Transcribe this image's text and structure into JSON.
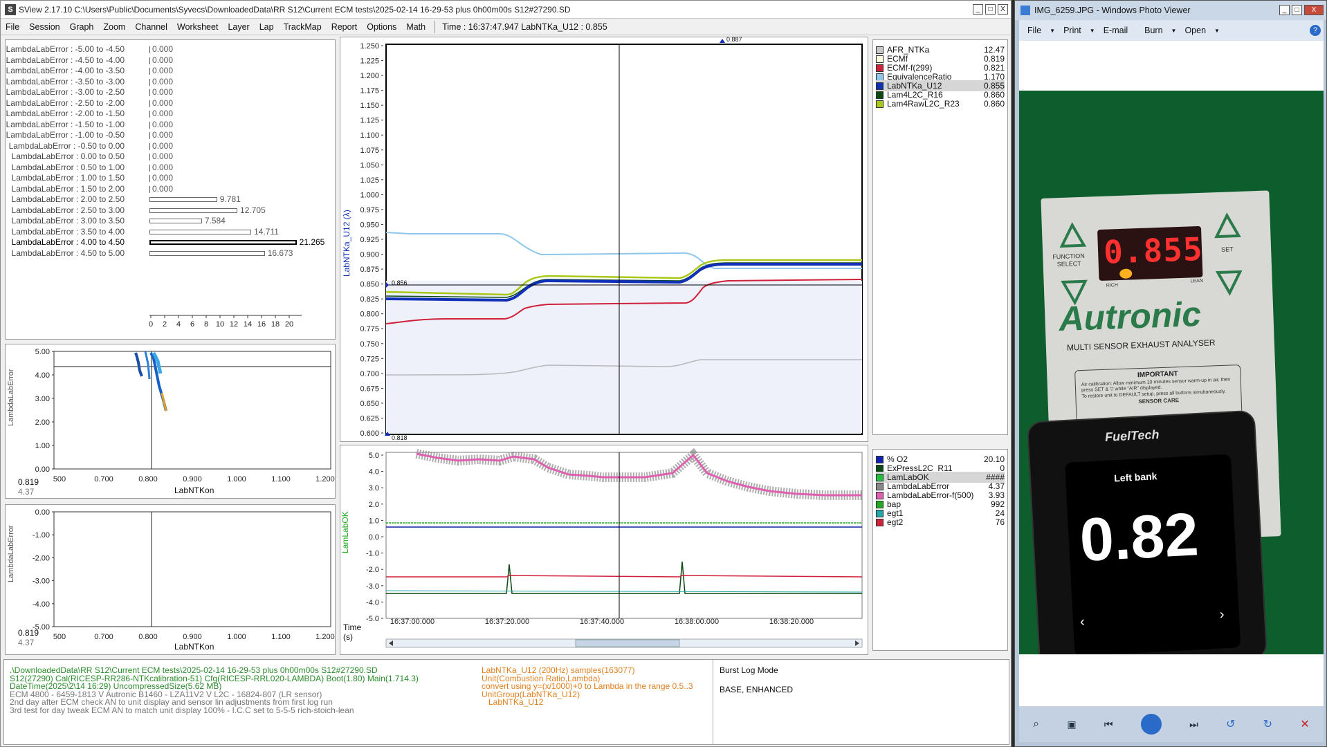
{
  "app": {
    "title": "SView 2.17.10   C:\\Users\\Public\\Documents\\Syvecs\\DownloadedData\\RR S12\\Current ECM tests\\2025-02-14 16-29-53 plus 0h00m00s S12#27290.SD",
    "window_buttons": [
      "_",
      "□",
      "X"
    ]
  },
  "menu": {
    "items": [
      "File",
      "Session",
      "Graph",
      "Zoom",
      "Channel",
      "Worksheet",
      "Layer",
      "Lap",
      "TrackMap",
      "Report",
      "Options",
      "Math"
    ],
    "time_readout": "Time : 16:37:47.947   LabNTKa_U12 : 0.855"
  },
  "histogram": {
    "rows": [
      {
        "label": "LambdaLabError : -5.00 to -4.50",
        "value": "0.000",
        "n": 0
      },
      {
        "label": "LambdaLabError : -4.50 to -4.00",
        "value": "0.000",
        "n": 0
      },
      {
        "label": "LambdaLabError : -4.00 to -3.50",
        "value": "0.000",
        "n": 0
      },
      {
        "label": "LambdaLabError : -3.50 to -3.00",
        "value": "0.000",
        "n": 0
      },
      {
        "label": "LambdaLabError : -3.00 to -2.50",
        "value": "0.000",
        "n": 0
      },
      {
        "label": "LambdaLabError : -2.50 to -2.00",
        "value": "0.000",
        "n": 0
      },
      {
        "label": "LambdaLabError : -2.00 to -1.50",
        "value": "0.000",
        "n": 0
      },
      {
        "label": "LambdaLabError : -1.50 to -1.00",
        "value": "0.000",
        "n": 0
      },
      {
        "label": "LambdaLabError : -1.00 to -0.50",
        "value": "0.000",
        "n": 0
      },
      {
        "label": "LambdaLabError : -0.50 to 0.00",
        "value": "0.000",
        "n": 0
      },
      {
        "label": "LambdaLabError : 0.00 to 0.50",
        "value": "0.000",
        "n": 0
      },
      {
        "label": "LambdaLabError : 0.50 to 1.00",
        "value": "0.000",
        "n": 0
      },
      {
        "label": "LambdaLabError : 1.00 to 1.50",
        "value": "0.000",
        "n": 0
      },
      {
        "label": "LambdaLabError : 1.50 to 2.00",
        "value": "0.000",
        "n": 0
      },
      {
        "label": "LambdaLabError : 2.00 to 2.50",
        "value": "9.781",
        "n": 9.781
      },
      {
        "label": "LambdaLabError : 2.50 to 3.00",
        "value": "12.705",
        "n": 12.705
      },
      {
        "label": "LambdaLabError : 3.00 to 3.50",
        "value": "7.584",
        "n": 7.584
      },
      {
        "label": "LambdaLabError : 3.50 to 4.00",
        "value": "14.711",
        "n": 14.711
      },
      {
        "label": "LambdaLabError : 4.00 to 4.50",
        "value": "21.265",
        "n": 21.265,
        "selected": true
      },
      {
        "label": "LambdaLabError : 4.50 to 5.00",
        "value": "16.673",
        "n": 16.673
      }
    ],
    "axis_ticks": [
      "0",
      "2",
      "4",
      "6",
      "8",
      "10",
      "12",
      "14",
      "16",
      "18",
      "20"
    ]
  },
  "scatter1": {
    "ylabel": "LambdaLabError",
    "xlabel": "LabNTKon",
    "yticks": [
      "5.00",
      "4.00",
      "3.00",
      "2.00",
      "1.00",
      "0.00"
    ],
    "xticks": [
      "500",
      "0.700",
      "0.800",
      "0.900",
      "1.000",
      "1.100",
      "1.200"
    ],
    "readout_x": "0.819",
    "readout_y": "4.37"
  },
  "scatter2": {
    "ylabel": "LambdaLabError",
    "xlabel": "LabNTKon",
    "yticks": [
      "0.00",
      "-1.00",
      "-2.00",
      "-3.00",
      "-4.00",
      "-5.00"
    ],
    "xticks": [
      "500",
      "0.700",
      "0.800",
      "0.900",
      "1.000",
      "1.100",
      "1.200"
    ],
    "readout_x": "0.819",
    "readout_y": "4.37"
  },
  "main_graph": {
    "ylabel": "LabNTKa_U12 (λ)",
    "yticks": [
      "1.250",
      "1.225",
      "1.200",
      "1.175",
      "1.150",
      "1.125",
      "1.100",
      "1.075",
      "1.050",
      "1.025",
      "1.000",
      "0.975",
      "0.950",
      "0.925",
      "0.900",
      "0.875",
      "0.850",
      "0.825",
      "0.800",
      "0.775",
      "0.750",
      "0.725",
      "0.700",
      "0.675",
      "0.650",
      "0.625",
      "0.600"
    ],
    "max_marker": "0.887",
    "min_marker": "0.818",
    "cursor_marker": "0.856"
  },
  "lower_graph": {
    "ylabel": "LamLabOK",
    "yticks": [
      "5.0",
      "4.0",
      "3.0",
      "2.0",
      "1.0",
      "0.0",
      "-1.0",
      "-2.0",
      "-3.0",
      "-4.0",
      "-5.0"
    ],
    "xlabel": "Time\n(s)",
    "xlabel_line1": "Time",
    "xlabel_line2": "(s)",
    "xticks": [
      "16:37:00.000",
      "16:37:20.000",
      "16:37:40.000",
      "16:38:00.000",
      "16:38:20.000"
    ]
  },
  "legend_top": [
    {
      "name": "AFR_NTKa",
      "value": "12.47",
      "color": "#c8c8c8"
    },
    {
      "name": "ECMf",
      "value": "0.819",
      "color": "#fffbe0"
    },
    {
      "name": "ECMf-f(299)",
      "value": "0.821",
      "color": "#d0203a"
    },
    {
      "name": "EquivalenceRatio",
      "value": "1.170",
      "color": "#8fc6ec"
    },
    {
      "name": "LabNTKa_U12",
      "value": "0.855",
      "color": "#1030b8",
      "selected": true
    },
    {
      "name": "Lam4L2C_R16",
      "value": "0.860",
      "color": "#0b4a12"
    },
    {
      "name": "Lam4RawL2C_R23",
      "value": "0.860",
      "color": "#a8c818"
    }
  ],
  "legend_bottom": [
    {
      "name": "% O2",
      "value": "20.10",
      "color": "#1020b0"
    },
    {
      "name": "ExPressL2C_R11",
      "value": "0",
      "color": "#0b4a12"
    },
    {
      "name": "LamLabOK",
      "value": "####",
      "color": "#22c040",
      "selected": true
    },
    {
      "name": "LambdaLabError",
      "value": "4.37",
      "color": "#888888"
    },
    {
      "name": "LambdaLabError-f(500)",
      "value": "3.93",
      "color": "#e060b0"
    },
    {
      "name": "bap",
      "value": "992",
      "color": "#22aa22"
    },
    {
      "name": "egt1",
      "value": "24",
      "color": "#20a8a8"
    },
    {
      "name": "egt2",
      "value": "76",
      "color": "#d0203a"
    }
  ],
  "status": {
    "left": [
      {
        "text": ".\\DownloadedData\\RR S12\\Current ECM tests\\2025-02-14 16-29-53 plus 0h00m00s S12#27290.SD",
        "color": "#2a8a2a"
      },
      {
        "text": "S12(27290) Cal(RICESP-RR286-NTKcalibration-51) Cfg(RICESP-RRL020-LAMBDA) Boot(1.80) Main(1.714.3)",
        "color": "#2a8a2a"
      },
      {
        "text": "DateTime(2025\\2\\14 16:29) UncompressedSize(5.62 MB)",
        "color": "#2a8a2a"
      },
      {
        "text": "ECM 4800 - 6459-1813 V Autronic B1460 - LZA11V2 V L2C - 16824-807 (LR sensor)",
        "color": "#777777"
      },
      {
        "text": "2nd day after ECM check AN to unit display and sensor lin adjustments from first log run",
        "color": "#777777"
      },
      {
        "text": "3rd test for day tweak ECM AN to match unit display 100% - I.C.C set to 5-5-5 rich-stoich-lean",
        "color": "#777777"
      }
    ],
    "mid": [
      "LabNTKa_U12 (200Hz) samples(163077)",
      "Unit(Combustion Ratio,Lambda)",
      "convert using y=(x/1000)+0 to Lambda in the range 0.5..3",
      "UnitGroup(LabNTKa_U12)",
      "   LabNTKa_U12"
    ],
    "right": [
      "Burst Log Mode",
      "BASE, ENHANCED"
    ]
  },
  "photo_viewer": {
    "title": "IMG_6259.JPG - Windows Photo Viewer",
    "menu": [
      "File",
      "Print",
      "E-mail",
      "Burn",
      "Open"
    ],
    "display1": "0.855",
    "brand": "Autronic",
    "subtitle": "MULTI SENSOR EXHAUST ANALYSER",
    "function_select": "FUNCTION\nSELECT",
    "function_select_line1": "FUNCTION",
    "function_select_line2": "SELECT",
    "set_label": "SET",
    "rich": "RICH",
    "lean": "LEAN",
    "important": "IMPORTANT",
    "important_text": "Air calibration: Allow minimum 10 minutes sensor warm-up in air, then press SET & ▽ while \"AIR\" displayed.",
    "important_text2": "To restore unit to DEFAULT setup, press all buttons simultaneously.",
    "sensor_care": "SENSOR CARE",
    "fueltech": "FuelTech",
    "left_bank": "Left bank",
    "display2": "0.82"
  }
}
